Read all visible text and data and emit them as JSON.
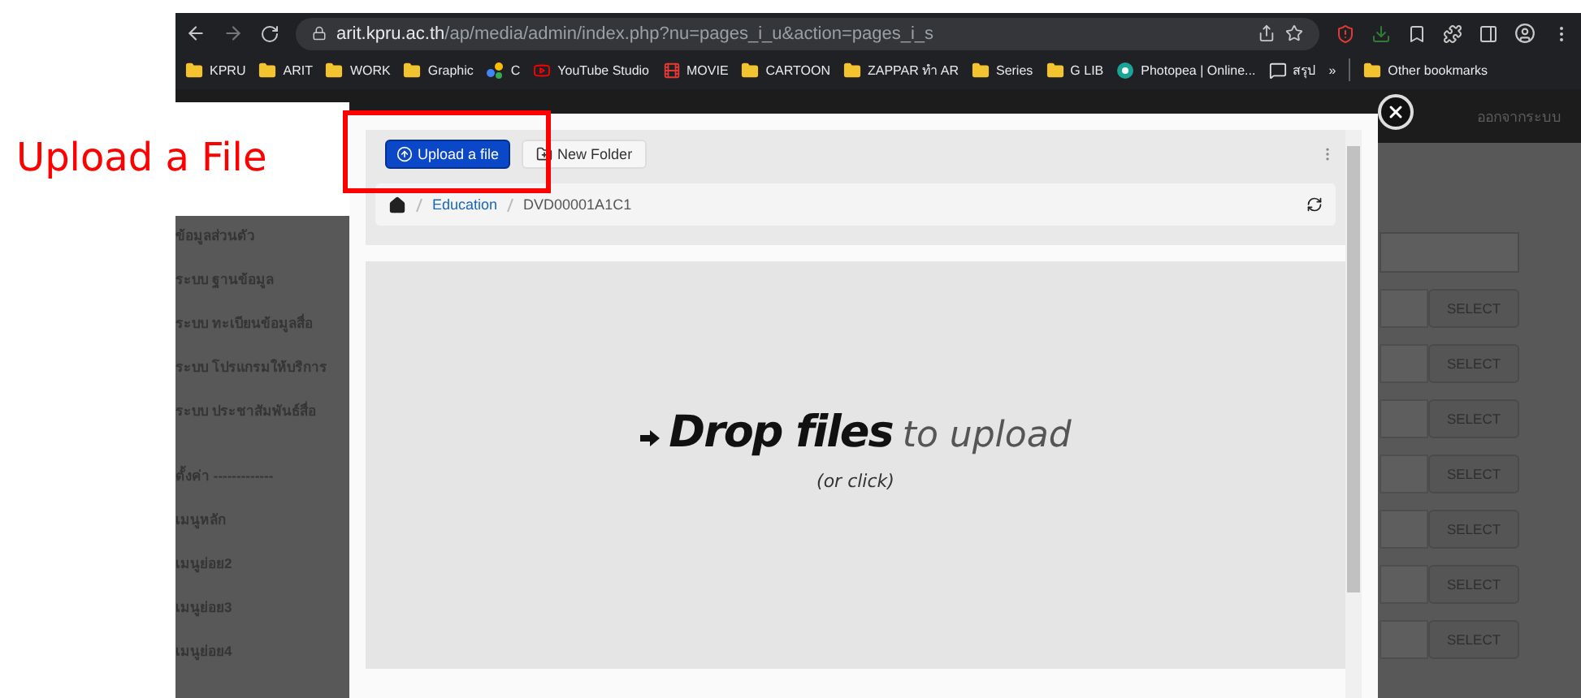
{
  "annotation": {
    "label": "Upload a File"
  },
  "browser": {
    "url_host": "arit.kpru.ac.th",
    "url_path": "/ap/media/admin/index.php?nu=pages_i_u&action=pages_i_s",
    "bookmarks": [
      {
        "label": "KPRU",
        "kind": "folder"
      },
      {
        "label": "ARIT",
        "kind": "folder"
      },
      {
        "label": "WORK",
        "kind": "folder"
      },
      {
        "label": "Graphic",
        "kind": "folder"
      },
      {
        "label": "C",
        "kind": "dots"
      },
      {
        "label": "YouTube Studio",
        "kind": "video"
      },
      {
        "label": "MOVIE",
        "kind": "film"
      },
      {
        "label": "CARTOON",
        "kind": "folder"
      },
      {
        "label": "ZAPPAR ทำ AR",
        "kind": "folder"
      },
      {
        "label": "Series",
        "kind": "folder"
      },
      {
        "label": "G LIB",
        "kind": "folder"
      },
      {
        "label": "Photopea | Online...",
        "kind": "app"
      },
      {
        "label": "สรุป",
        "kind": "chat"
      }
    ],
    "overflow": "»",
    "other_bookmarks": "Other bookmarks"
  },
  "admin": {
    "logout": "ออกจากระบบ",
    "sidebar": [
      "ข้อมูลส่วนตัว",
      "ระบบ ฐานข้อมูล",
      "ระบบ ทะเบียนข้อมูลสื่อ",
      "ระบบ โปรแกรมให้บริการ",
      "ระบบ ประชาสัมพันธ์สื่อ",
      "ตั้งค่า -------------",
      "เมนูหลัก",
      "เมนูย่อย2",
      "เมนูย่อย3",
      "เมนูย่อย4"
    ],
    "select_buttons": [
      "SELECT",
      "SELECT",
      "SELECT",
      "SELECT",
      "SELECT",
      "SELECT",
      "SELECT"
    ]
  },
  "modal": {
    "upload_button": "Upload a file",
    "new_folder_button": "New Folder",
    "breadcrumb": [
      {
        "label": "Education",
        "current": false
      },
      {
        "label": "DVD00001A1C1",
        "current": true
      }
    ],
    "drop_title": "Drop files",
    "drop_subtitle": "to upload",
    "drop_hint": "(or click)"
  }
}
